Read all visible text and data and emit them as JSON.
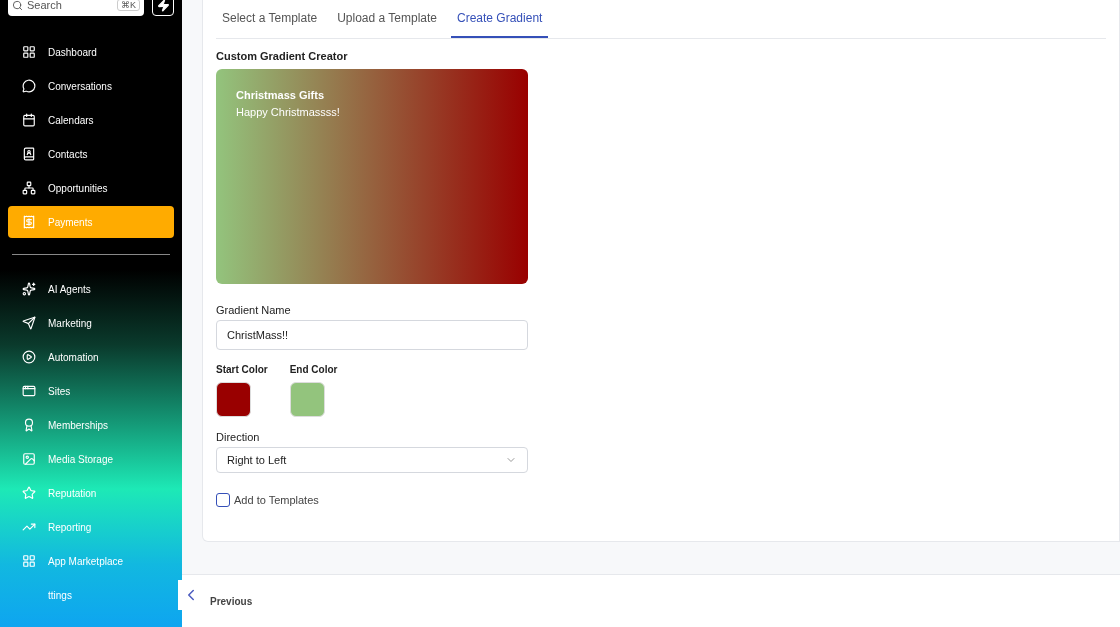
{
  "sidebar": {
    "search": {
      "placeholder": "Search",
      "shortcut": "⌘K"
    },
    "items": [
      {
        "label": "Dashboard",
        "selected": false
      },
      {
        "label": "Conversations",
        "selected": false
      },
      {
        "label": "Calendars",
        "selected": false
      },
      {
        "label": "Contacts",
        "selected": false
      },
      {
        "label": "Opportunities",
        "selected": false
      },
      {
        "label": "Payments",
        "selected": true
      }
    ],
    "items2": [
      {
        "label": "AI Agents",
        "selected": false
      },
      {
        "label": "Marketing",
        "selected": false
      },
      {
        "label": "Automation",
        "selected": false
      },
      {
        "label": "Sites",
        "selected": false
      },
      {
        "label": "Memberships",
        "selected": false
      },
      {
        "label": "Media Storage",
        "selected": false
      },
      {
        "label": "Reputation",
        "selected": false
      },
      {
        "label": "Reporting",
        "selected": false
      },
      {
        "label": "App Marketplace",
        "selected": false
      },
      {
        "label": "ttings",
        "selected": false
      }
    ]
  },
  "tabs": [
    {
      "label": "Select a Template",
      "selected": false
    },
    {
      "label": "Upload a Template",
      "selected": false
    },
    {
      "label": "Create Gradient",
      "selected": true
    }
  ],
  "section_title": "Custom Gradient Creator",
  "preview": {
    "title": "Christmass Gifts",
    "subtitle": "Happy Christmassss!"
  },
  "gradient_name": {
    "label": "Gradient Name",
    "value": "ChristMass!!"
  },
  "start_color": {
    "label": "Start Color",
    "color": "#990000"
  },
  "end_color": {
    "label": "End Color",
    "color": "#93c47d"
  },
  "direction": {
    "label": "Direction",
    "value": "Right to Left"
  },
  "add_to_templates": {
    "label": "Add to Templates",
    "checked": false
  },
  "previous_button": "Previous"
}
